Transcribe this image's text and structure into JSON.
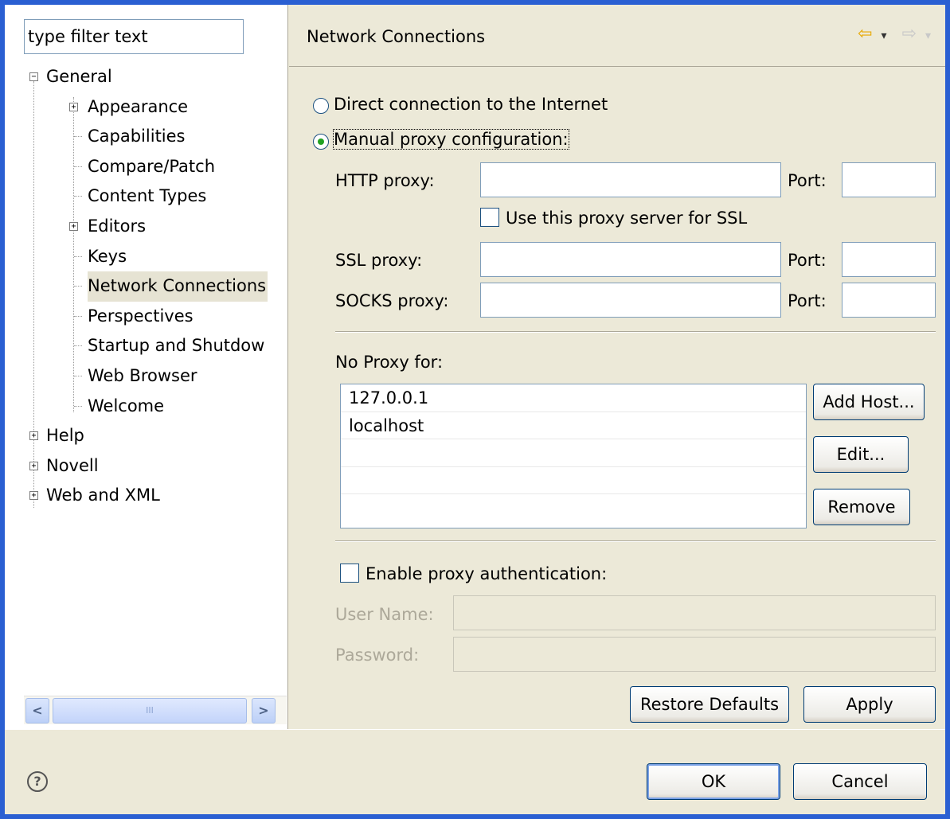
{
  "filter": {
    "placeholder": "type filter text"
  },
  "tree": {
    "general": "General",
    "general_children": [
      "Appearance",
      "Capabilities",
      "Compare/Patch",
      "Content Types",
      "Editors",
      "Keys",
      "Network Connections",
      "Perspectives",
      "Startup and Shutdow",
      "Web Browser",
      "Welcome"
    ],
    "help": "Help",
    "novell": "Novell",
    "webxml": "Web and XML"
  },
  "scrollbar": {
    "left": "<",
    "right": ">",
    "thumb": "III"
  },
  "page": {
    "title": "Network Connections"
  },
  "radios": {
    "direct": "Direct connection to the Internet",
    "manual": "Manual proxy configuration:"
  },
  "fields": {
    "http_proxy": "HTTP proxy:",
    "port": "Port:",
    "use_for_ssl": "Use this proxy server for SSL",
    "ssl_proxy": "SSL proxy:",
    "socks_proxy": "SOCKS proxy:"
  },
  "no_proxy": {
    "label": "No Proxy for:",
    "hosts": [
      "127.0.0.1",
      "localhost"
    ],
    "add_host": "Add Host...",
    "edit": "Edit...",
    "remove": "Remove"
  },
  "auth": {
    "enable": "Enable proxy authentication:",
    "user_name": "User Name:",
    "password": "Password:"
  },
  "buttons": {
    "restore_defaults": "Restore Defaults",
    "apply": "Apply",
    "ok": "OK",
    "cancel": "Cancel"
  },
  "icons": {
    "help": "?",
    "back": "⇦",
    "forward": "⇨",
    "dropdown": "▾"
  },
  "colors": {
    "titlebar_border": "#2a5fd2",
    "dialog_bg": "#ece9d8",
    "selection": "#e6e3d3"
  }
}
